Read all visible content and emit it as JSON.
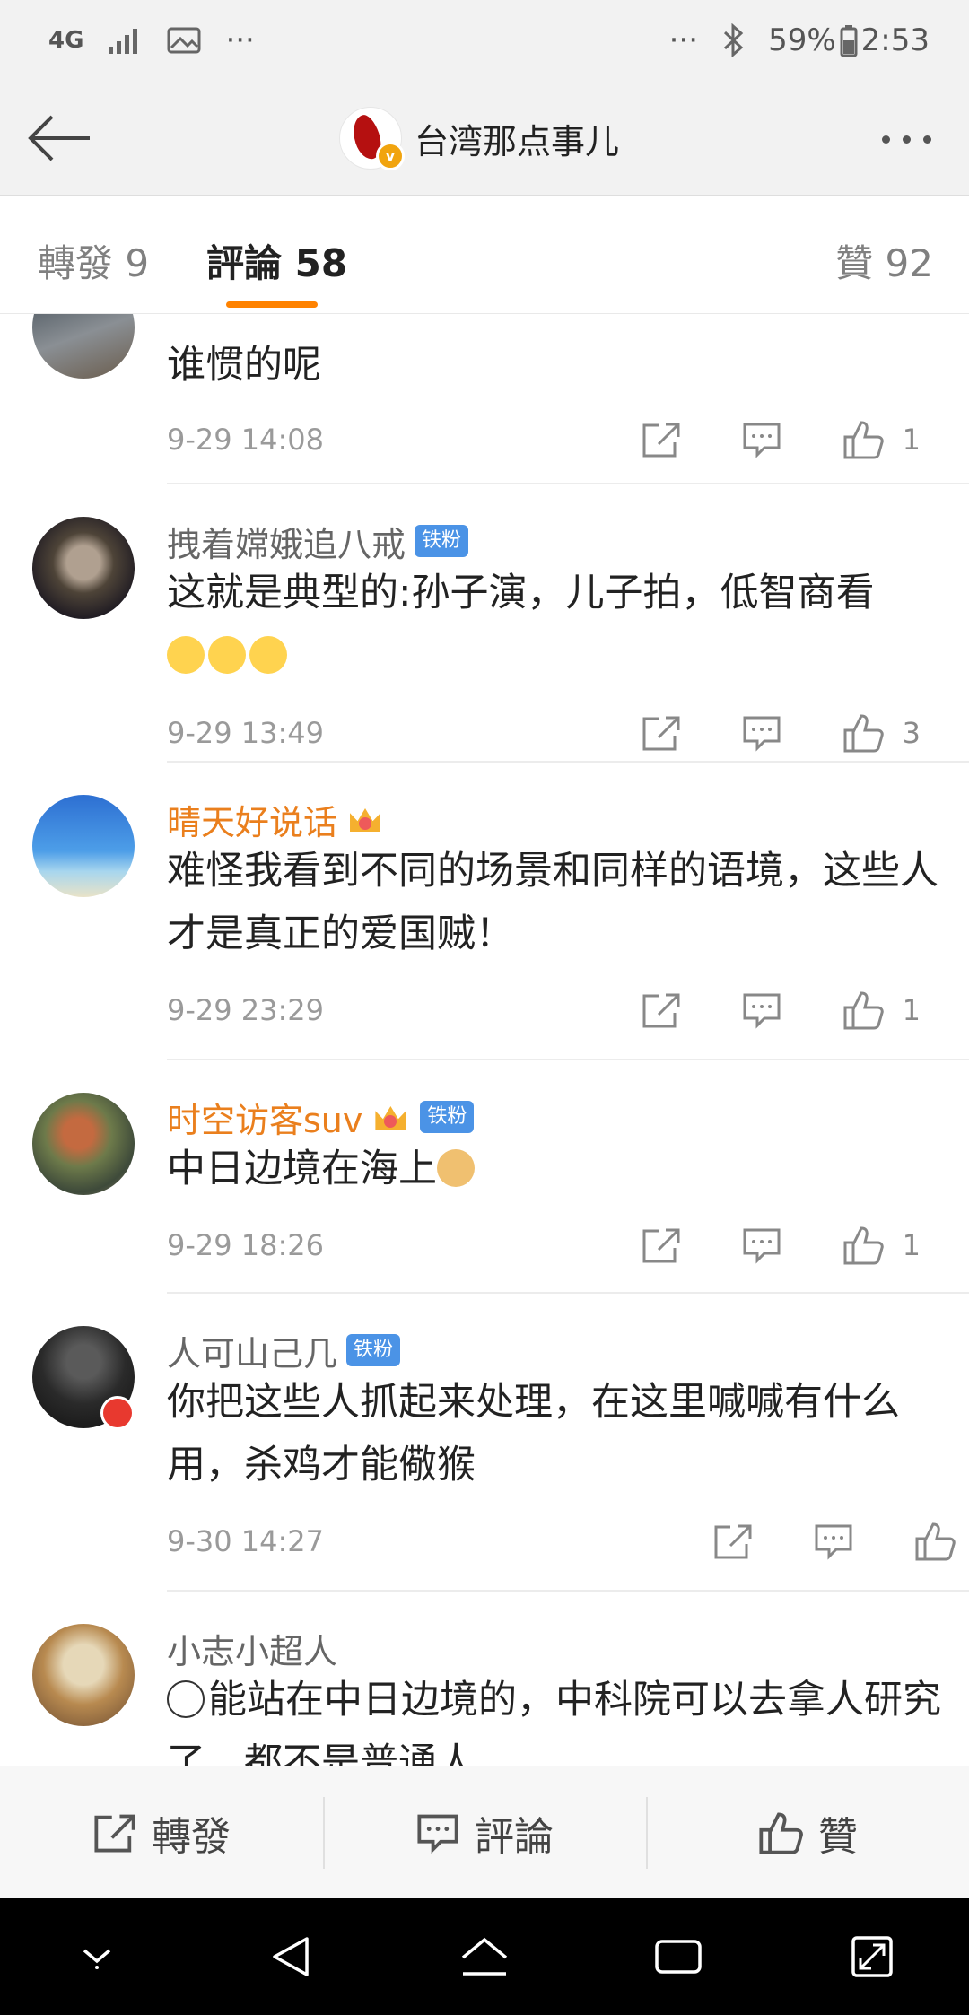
{
  "status_bar": {
    "network": "4G",
    "battery": "59%",
    "time": "2:53",
    "more": "···"
  },
  "header": {
    "title": "台湾那点事儿",
    "verified": "v"
  },
  "tabs": [
    {
      "label": "轉發 9"
    },
    {
      "label": "評論 58"
    },
    {
      "label": "贊 92"
    }
  ],
  "comments": [
    {
      "user": "",
      "badge": "",
      "text": "谁惯的呢",
      "time": "9-29 14:08",
      "likes": "1"
    },
    {
      "user": "拽着嫦娥追八戒",
      "badge": "铁粉",
      "text": "这就是典型的:孙子演，儿子拍，低智商看",
      "time": "9-29 13:49",
      "likes": "3"
    },
    {
      "user": "晴天好说话",
      "badge": "",
      "text": "难怪我看到不同的场景和同样的语境，这些人才是真正的爱国贼！",
      "time": "9-29 23:29",
      "likes": "1"
    },
    {
      "user": "时空访客suv",
      "badge": "铁粉",
      "text": "中日边境在海上",
      "time": "9-29 18:26",
      "likes": "1"
    },
    {
      "user": "人可山己几",
      "badge": "铁粉",
      "text": "你把这些人抓起来处理，在这里喊喊有什么用，杀鸡才能儆猴",
      "time": "9-30 14:27",
      "likes": ""
    },
    {
      "user": "小志小超人",
      "badge": "",
      "text": "能站在中日边境的，中科院可以去拿人研究了，都不是普通人",
      "time": "",
      "likes": ""
    }
  ],
  "bottom_bar": {
    "repost": "轉發",
    "comment": "評論",
    "like": "贊"
  },
  "colors": {
    "accent": "#ff8200",
    "vip_name": "#ea7f1d",
    "fan_badge": "#4b93e6"
  }
}
